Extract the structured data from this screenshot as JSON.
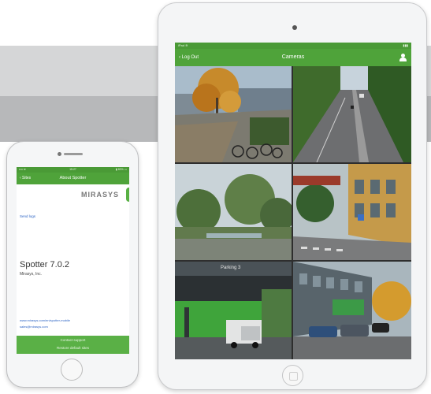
{
  "ipad": {
    "status_left": "iPad ≋",
    "status_right": "▮▮▮",
    "nav_back": "‹ Log Out",
    "nav_title": "Cameras",
    "user_icon": "user-icon",
    "camera_labels": [
      "",
      "",
      "",
      "",
      "Parking 3",
      ""
    ]
  },
  "iphone": {
    "status_left": "•••• ≋",
    "status_time": "15:27",
    "status_right": "▮ 83% ▭",
    "nav_back": "‹ Sites",
    "nav_title": "About Spotter",
    "logo_text": "MIRASYS",
    "send_logs": "Send logs",
    "app_name": "Spotter 7.0.2",
    "company": "Mirasys, Inc.",
    "link_web": "www.mirasys.com/en/spotter-mobile",
    "link_email": "sales@mirasys.com",
    "btn_contact": "Contact support",
    "btn_restore": "Restore default sites"
  },
  "colors": {
    "brand_green": "#4fa33a",
    "link_blue": "#2a62c4"
  }
}
